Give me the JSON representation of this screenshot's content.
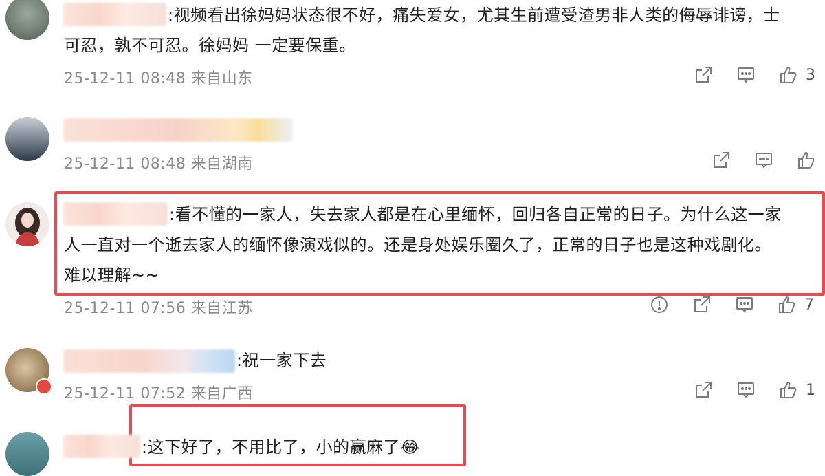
{
  "comments": [
    {
      "text_line1": ":视频看出徐妈妈状态很不好，痛失爱女，尤其生前遭受渣男非人类的侮辱诽谤，士",
      "text_line2": "可忍，孰不可忍。徐妈妈 一定要保重。",
      "time": "25-12-11 08:48 来自山东",
      "likes": "3"
    },
    {
      "time": "25-12-11 08:48 来自湖南",
      "likes": ""
    },
    {
      "text_line1": ":看不懂的一家人，失去家人都是在心里缅怀，回归各自正常的日子。为什么这一家",
      "text_line2": "人一直对一个逝去家人的缅怀像演戏似的。还是身处娱乐圈久了，正常的日子也是这种戏剧化。",
      "text_line3": "难以理解~~",
      "time": "25-12-11 07:56 来自江苏",
      "likes": "7"
    },
    {
      "text_line1": ":祝一家下去",
      "time": "25-12-11 07:52 来自广西",
      "likes": "1"
    },
    {
      "text_line1": ":这下好了，不用比了，小的赢麻了",
      "emoji": "😂"
    }
  ],
  "icons": {
    "share": "share-icon",
    "comment": "comment-icon",
    "like": "like-icon",
    "report": "report-icon"
  },
  "colors": {
    "highlight": "#e84a4e",
    "meta": "#8a8a8a"
  }
}
